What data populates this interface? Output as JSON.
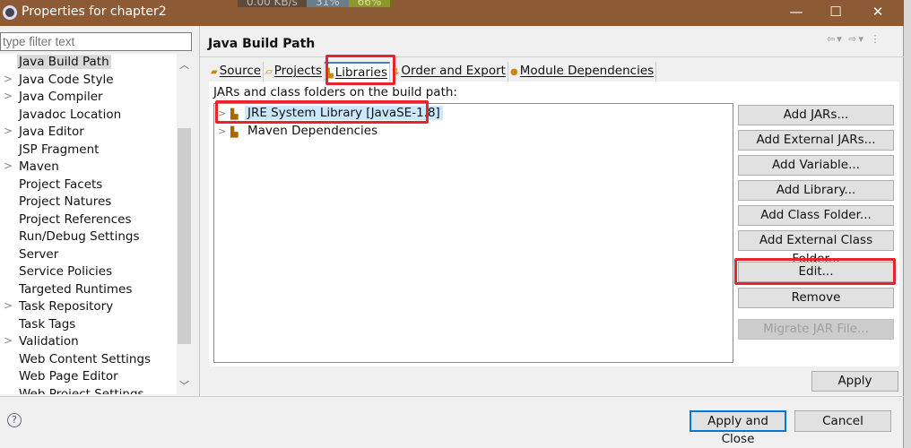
{
  "window": {
    "title": "Properties for chapter2",
    "titlebar_color": "#8c5b36"
  },
  "overlay": {
    "speed": "0.00 KB/s",
    "cpu": "31%",
    "mem": "66%"
  },
  "filter": {
    "placeholder": "type filter text"
  },
  "tree": [
    {
      "label": "Java Build Path",
      "expandable": false,
      "selected": true
    },
    {
      "label": "Java Code Style",
      "expandable": true
    },
    {
      "label": "Java Compiler",
      "expandable": true
    },
    {
      "label": "Javadoc Location",
      "expandable": false
    },
    {
      "label": "Java Editor",
      "expandable": true
    },
    {
      "label": "JSP Fragment",
      "expandable": false
    },
    {
      "label": "Maven",
      "expandable": true
    },
    {
      "label": "Project Facets",
      "expandable": false
    },
    {
      "label": "Project Natures",
      "expandable": false
    },
    {
      "label": "Project References",
      "expandable": false
    },
    {
      "label": "Run/Debug Settings",
      "expandable": false
    },
    {
      "label": "Server",
      "expandable": false
    },
    {
      "label": "Service Policies",
      "expandable": false
    },
    {
      "label": "Targeted Runtimes",
      "expandable": false
    },
    {
      "label": "Task Repository",
      "expandable": true
    },
    {
      "label": "Task Tags",
      "expandable": false
    },
    {
      "label": "Validation",
      "expandable": true
    },
    {
      "label": "Web Content Settings",
      "expandable": false
    },
    {
      "label": "Web Page Editor",
      "expandable": false
    },
    {
      "label": "Web Project Settings",
      "expandable": false
    }
  ],
  "page": {
    "title": "Java Build Path",
    "tabs": [
      {
        "label": "Source",
        "icon": "source-folder-icon"
      },
      {
        "label": "Projects",
        "icon": "projects-folder-icon"
      },
      {
        "label": "Libraries",
        "icon": "library-icon",
        "active": true
      },
      {
        "label": "Order and Export",
        "icon": "order-export-icon"
      },
      {
        "label": "Module Dependencies",
        "icon": "module-icon"
      }
    ],
    "list_label": "JARs and class folders on the build path:",
    "entries": [
      {
        "label": "JRE System Library [JavaSE-1.8]",
        "selected": true
      },
      {
        "label": "Maven Dependencies"
      }
    ],
    "buttons": [
      "Add JARs...",
      "Add External JARs...",
      "Add Variable...",
      "Add Library...",
      "Add Class Folder...",
      "Add External Class Folder...",
      "Edit...",
      "Remove",
      "Migrate JAR File..."
    ],
    "apply": "Apply"
  },
  "footer": {
    "apply_close": "Apply and Close",
    "cancel": "Cancel"
  },
  "highlight_color": "#e8242b"
}
